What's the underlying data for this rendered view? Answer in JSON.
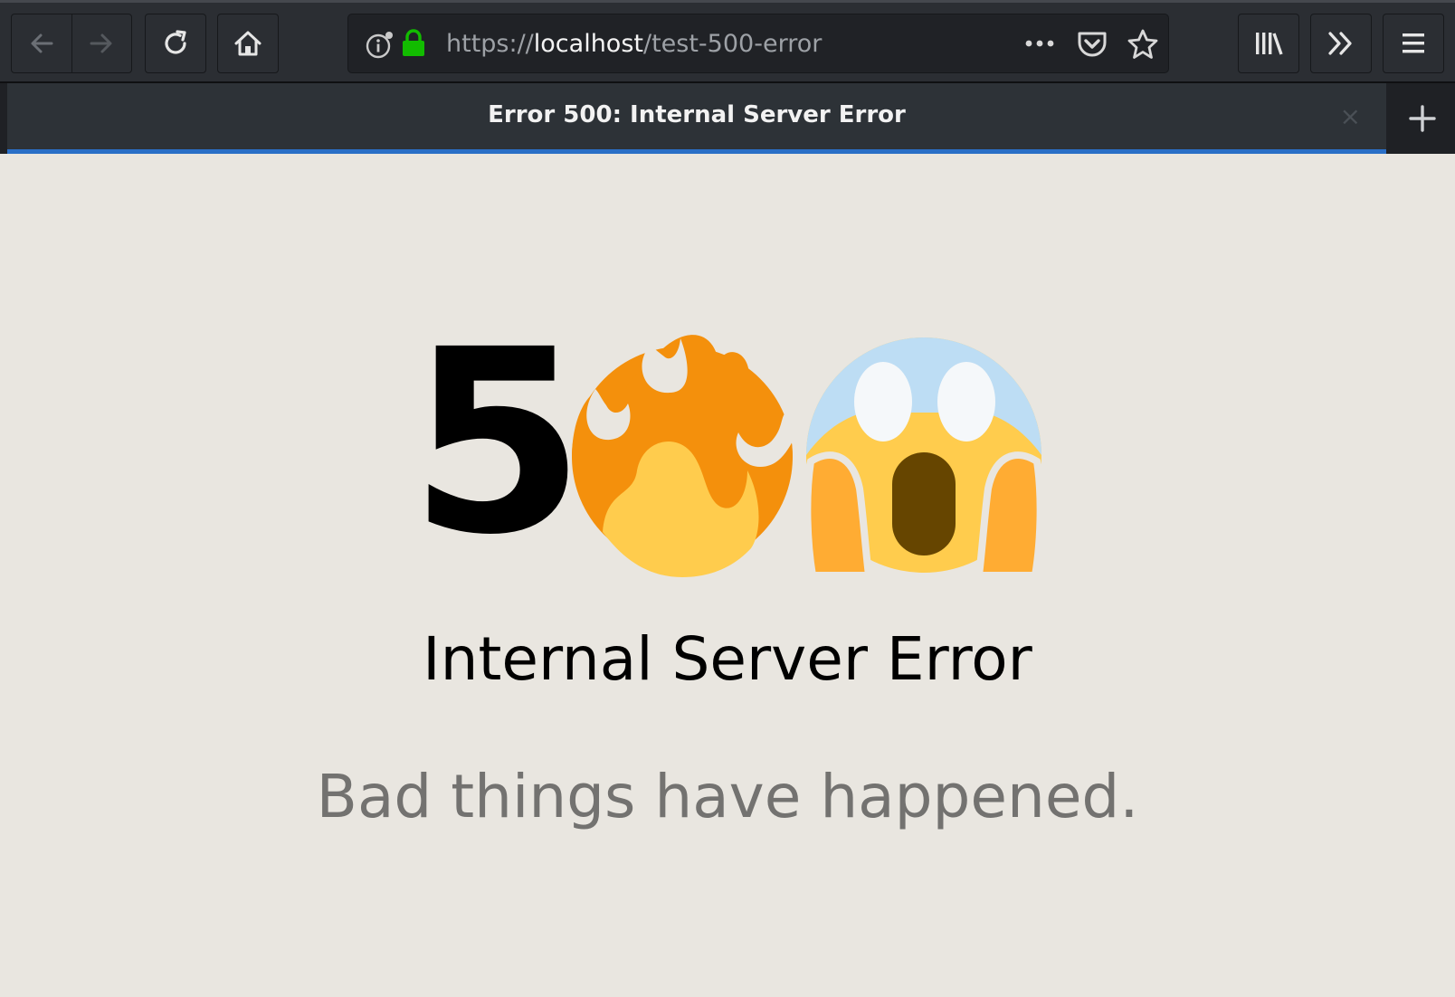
{
  "browser": {
    "url_scheme": "https://",
    "url_host": "localhost",
    "url_path": "/test-500-error",
    "tab_title": "Error 500: Internal Server Error",
    "tab_close": "×",
    "colors": {
      "accent": "#2a6fc7",
      "lock": "#12bc00"
    }
  },
  "page": {
    "code_digit": "5",
    "emoji": [
      "fire",
      "face-screaming-in-fear"
    ],
    "heading": "Internal Server Error",
    "message": "Bad things have happened."
  }
}
